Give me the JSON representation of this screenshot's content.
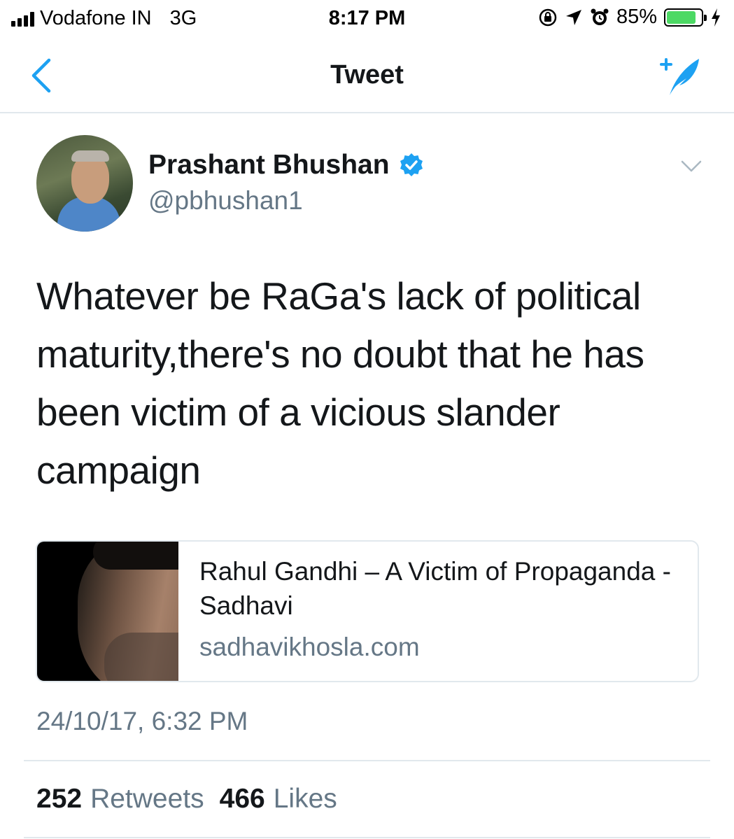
{
  "status_bar": {
    "carrier": "Vodafone IN",
    "network": "3G",
    "time": "8:17 PM",
    "battery_percent": "85%",
    "battery_level": 0.85,
    "icons": [
      "signal-icon",
      "rotation-lock-icon",
      "location-icon",
      "alarm-icon",
      "battery-icon",
      "charging-icon"
    ]
  },
  "nav": {
    "title": "Tweet",
    "back_icon": "chevron-left-icon",
    "compose_icon": "compose-tweet-icon"
  },
  "tweet": {
    "author_name": "Prashant Bhushan",
    "author_handle": "@pbhushan1",
    "verified": true,
    "text": "Whatever be RaGa's lack of political\nmaturity,there's no doubt that he has\nbeen victim of a vicious slander\ncampaign",
    "card": {
      "title": "Rahul Gandhi – A Victim of Propaganda - Sadhavi",
      "domain": "sadhavikhosla.com"
    },
    "timestamp": "24/10/17, 6:32 PM",
    "retweets_count": "252",
    "retweets_label": "Retweets",
    "likes_count": "466",
    "likes_label": "Likes"
  },
  "colors": {
    "accent": "#1da1f2",
    "text_primary": "#14171a",
    "text_secondary": "#657786",
    "divider": "#e1e8ed",
    "battery": "#4cd964"
  }
}
